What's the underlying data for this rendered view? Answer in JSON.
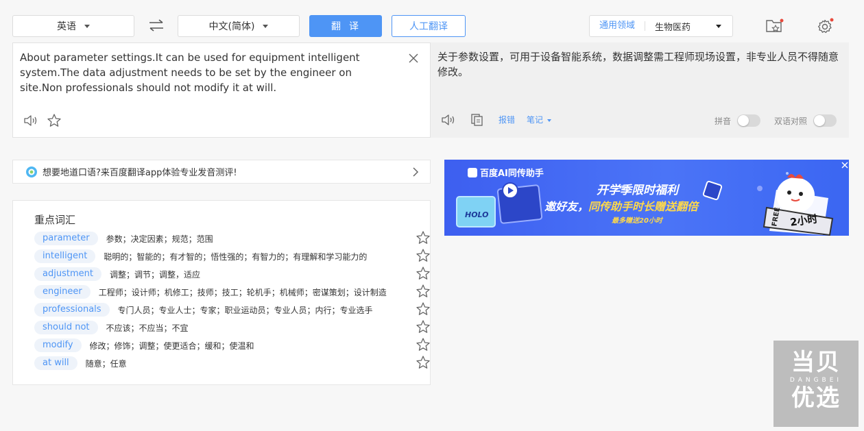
{
  "toolbar": {
    "source_lang": "英语",
    "target_lang": "中文(简体)",
    "translate_button": "翻译",
    "human_translate_button": "人工翻译",
    "domain_label": "通用领域",
    "domain_value": "生物医药"
  },
  "source": {
    "text": "About parameter settings.It can be used for equipment intelligent system.The data adjustment needs to be set by the engineer on site.Non professionals should not modify it at will."
  },
  "target": {
    "text": "关于参数设置，可用于设备智能系统，数据调整需工程师现场设置，非专业人员不得随意修改。",
    "report_link": "报错",
    "notes_link": "笔记",
    "pinyin_label": "拼音",
    "bilingual_label": "双语对照"
  },
  "promo": {
    "text": "想要地道口语?来百度翻译app体验专业发音测评!"
  },
  "vocab": {
    "title": "重点词汇",
    "items": [
      {
        "word": "parameter",
        "def": "参数；决定因素；规范；范围"
      },
      {
        "word": "intelligent",
        "def": "聪明的；智能的；有才智的；悟性强的；有智力的；有理解和学习能力的"
      },
      {
        "word": "adjustment",
        "def": "调整；调节；调整，适应"
      },
      {
        "word": "engineer",
        "def": "工程师；设计师；机修工；技师；技工；轮机手；机械师；密谋策划；设计制造"
      },
      {
        "word": "professionals",
        "def": "专门人员；专业人士；专家；职业运动员；专业人员；内行；专业选手"
      },
      {
        "word": "should not",
        "def": "不应该；不应当；不宜"
      },
      {
        "word": "modify",
        "def": "修改；修饰；调整；使更适合；缓和；使温和"
      },
      {
        "word": "at will",
        "def": "随意；任意"
      }
    ]
  },
  "banner": {
    "brand": "百度AI同传助手",
    "headline": "开学季限时福利",
    "subline_a": "邀好友，",
    "subline_b": "同传助手时长赠送翻倍",
    "note": "最多赠送20小时",
    "free_tag": "FREE",
    "hours": "2小时",
    "screen_text": "HOLO"
  },
  "watermark": {
    "top": "当贝",
    "middle": "DANGBEI",
    "bottom": "优选"
  },
  "colors": {
    "accent": "#4e95f5",
    "badge_dot": "#e84a3c",
    "banner_bg": "#4466f4",
    "banner_yellow": "#ffd94a"
  }
}
